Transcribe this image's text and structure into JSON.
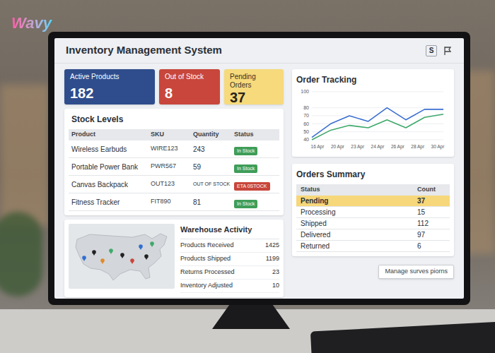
{
  "logo": {
    "text": "Wavy"
  },
  "window": {
    "title": "Inventory Management System",
    "icons": [
      "S"
    ]
  },
  "kpis": [
    {
      "label": "Active Products",
      "value": "182",
      "color": "#2f4d8c"
    },
    {
      "label": "Out of Stock",
      "value": "8",
      "color": "#c8463b"
    },
    {
      "label": "Pending Orders",
      "value": "37",
      "color": "#f6da7c"
    }
  ],
  "stock": {
    "title": "Stock Levels",
    "columns": [
      "Product",
      "SKU",
      "Quantity",
      "Status"
    ],
    "rows": [
      {
        "product": "Wireless Earbuds",
        "sku": "WIRE123",
        "quantity": "243",
        "status": "In Stock",
        "color": "#3f9d58"
      },
      {
        "product": "Portable Power Bank",
        "sku": "PWR567",
        "quantity": "59",
        "status": "In Stock",
        "color": "#3f9d58"
      },
      {
        "product": "Canvas Backpack",
        "sku": "OUT123",
        "quantity": "OUT OF STOCK",
        "status": "ETA 0STOCK",
        "color": "#c8463b"
      },
      {
        "product": "Fitness Tracker",
        "sku": "FIT890",
        "quantity": "81",
        "status": "In Stock",
        "color": "#3f9d58"
      }
    ]
  },
  "warehouse": {
    "title": "Warehouse Activity",
    "items": [
      {
        "label": "Products Received",
        "value": "1425"
      },
      {
        "label": "Products Shipped",
        "value": "1199"
      },
      {
        "label": "Returns Processed",
        "value": "23"
      },
      {
        "label": "Inventory Adjusted",
        "value": "10"
      }
    ],
    "pins": [
      {
        "color": "#2f6fd1"
      },
      {
        "color": "#222222"
      },
      {
        "color": "#e08a2c"
      },
      {
        "color": "#3fa96b"
      },
      {
        "color": "#222222"
      },
      {
        "color": "#c8463b"
      },
      {
        "color": "#2f6fd1"
      },
      {
        "color": "#3fa96b"
      },
      {
        "color": "#222222"
      }
    ]
  },
  "chart": {
    "title": "Order Tracking",
    "y_ticks": [
      "100",
      "80",
      "70",
      "60",
      "50",
      "40"
    ],
    "x_labels": [
      "16 Apr",
      "20 Apr",
      "23 Apr",
      "24 Apr",
      "26 Apr",
      "28 Apr",
      "30 Apr"
    ],
    "series": [
      {
        "values": [
          43,
          60,
          70,
          63,
          80,
          65,
          78,
          78
        ],
        "color": "#3b6fd1"
      },
      {
        "values": [
          40,
          52,
          58,
          55,
          65,
          55,
          68,
          72
        ],
        "color": "#3fa96b"
      }
    ]
  },
  "orders": {
    "title": "Orders Summary",
    "columns": [
      "Status",
      "Count"
    ],
    "rows": [
      {
        "status": "Pending",
        "count": "37",
        "selected": true
      },
      {
        "status": "Processing",
        "count": "15",
        "selected": false
      },
      {
        "status": "Shipped",
        "count": "112",
        "selected": false
      },
      {
        "status": "Delivered",
        "count": "97",
        "selected": false
      },
      {
        "status": "Returned",
        "count": "6",
        "selected": false
      }
    ]
  },
  "button": {
    "label": "Manage surves piorns"
  }
}
